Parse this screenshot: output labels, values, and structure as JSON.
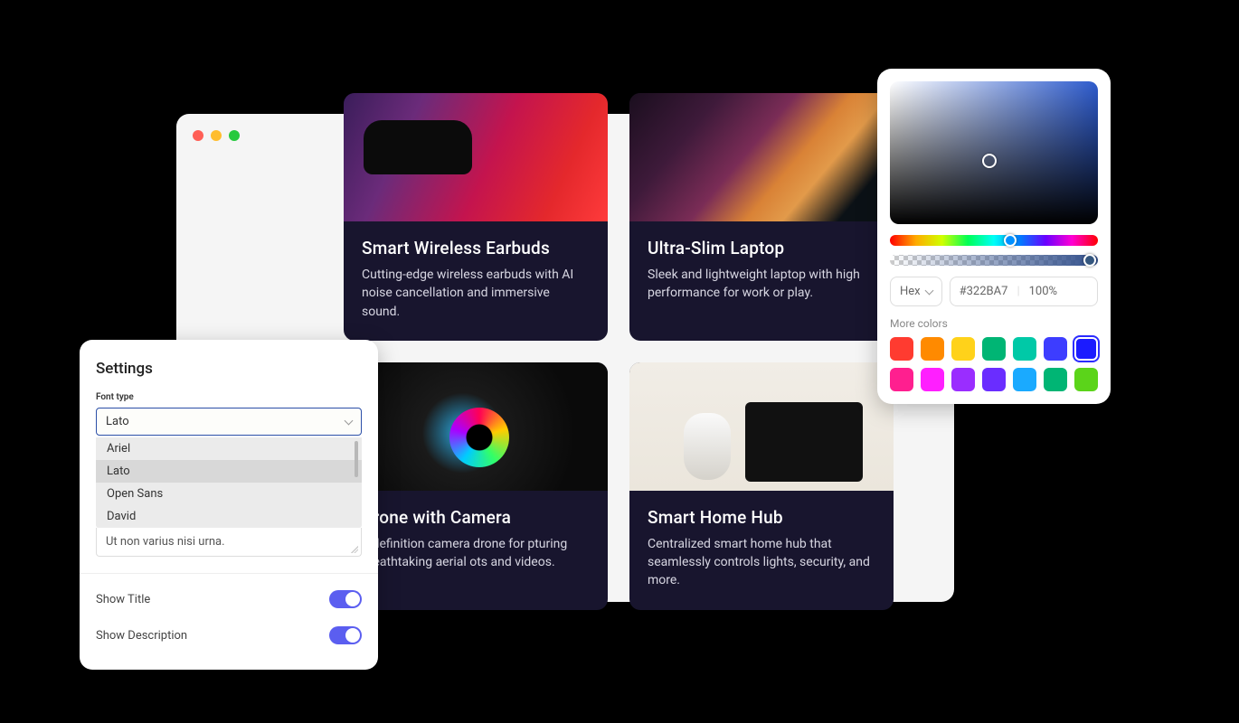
{
  "cards": [
    {
      "title": "Smart Wireless Earbuds",
      "desc": "Cutting-edge wireless earbuds with AI noise cancellation and immersive sound."
    },
    {
      "title": "Ultra-Slim Laptop",
      "desc": "Sleek and lightweight laptop with high performance for work or play."
    },
    {
      "title": "Drone with Camera",
      "desc": "h-definition camera drone for pturing breathtaking aerial ots and videos."
    },
    {
      "title": "Smart Home Hub",
      "desc": "Centralized smart home hub that seamlessly controls lights, security, and more."
    }
  ],
  "settings": {
    "title": "Settings",
    "font_label": "Font type",
    "font_selected": "Lato",
    "font_options": [
      "Ariel",
      "Lato",
      "Open Sans",
      "David"
    ],
    "textarea_text": "Ut non varius nisi urna.",
    "show_title_label": "Show Title",
    "show_desc_label": "Show Description"
  },
  "picker": {
    "mode": "Hex",
    "hex": "#322BA7",
    "opacity": "100%",
    "more_label": "More colors",
    "swatches": [
      "#ff3b30",
      "#ff8a00",
      "#ffd21a",
      "#00b574",
      "#00c9a7",
      "#3d3dff",
      "#1b1bff",
      "#ff1f8f",
      "#ff1fff",
      "#9a2dff",
      "#6a2dff",
      "#1aaaff",
      "#00b574",
      "#5bd41a"
    ],
    "selected_swatch_index": 6
  }
}
